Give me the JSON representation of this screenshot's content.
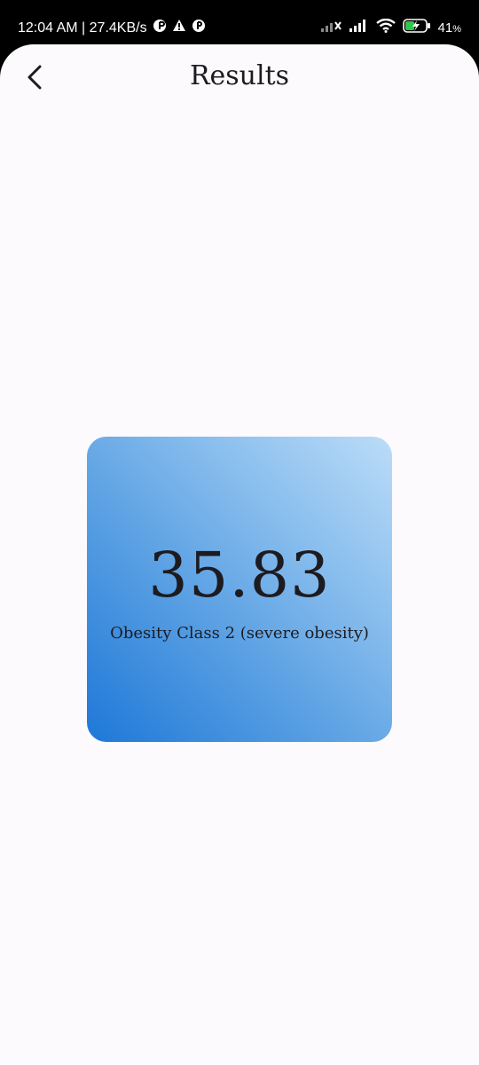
{
  "status_bar": {
    "time_speed": "12:04 AM | 27.4KB/s",
    "battery_percent": "41",
    "battery_unit": "%"
  },
  "header": {
    "title": "Results"
  },
  "result": {
    "bmi_value": "35.83",
    "category": "Obesity Class 2 (severe obesity)"
  },
  "colors": {
    "background": "#fdfafd",
    "card_gradient_start": "#1e78d8",
    "card_gradient_end": "#bcdcf8",
    "text": "#1d1b20"
  }
}
